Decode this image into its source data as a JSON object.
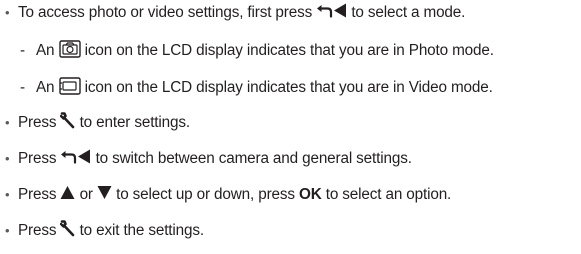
{
  "bullet_glyph": "•",
  "dash_glyph": "-",
  "items": [
    {
      "pre": "To access photo or video settings, first press",
      "icons": [
        "back-arrow-icon",
        "left-triangle-icon"
      ],
      "post": "to select a mode."
    },
    {
      "pre": "An",
      "icons": [
        "photo-mode-icon"
      ],
      "post": "icon on the LCD display indicates that you are in Photo mode."
    },
    {
      "pre": "An",
      "icons": [
        "video-mode-icon"
      ],
      "post": "icon on the LCD display indicates that you are in Video mode."
    },
    {
      "pre": "Press",
      "icons": [
        "wrench-icon"
      ],
      "post": "to enter settings."
    },
    {
      "pre": "Press",
      "icons": [
        "back-arrow-icon",
        "left-triangle-icon"
      ],
      "post": "to switch between camera and general settings."
    },
    {
      "pre": "Press",
      "mid1": "or",
      "mid2": "to select up or down, press",
      "ok": "OK",
      "post": "to select an option.",
      "icons": [
        "up-triangle-icon",
        "down-triangle-icon"
      ]
    },
    {
      "pre": "Press",
      "icons": [
        "wrench-icon"
      ],
      "post": "to exit the settings."
    }
  ],
  "colors": {
    "text": "#231f20",
    "bullet": "#58595b"
  }
}
